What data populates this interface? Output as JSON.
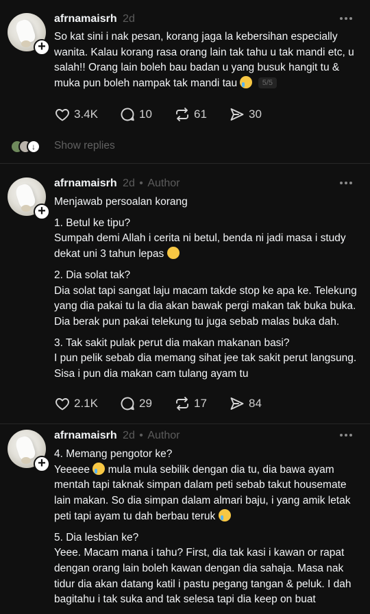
{
  "posts": [
    {
      "username": "afrnamaisrh",
      "time": "2d",
      "author_badge": "",
      "paragraphs": [
        "So kat sini i nak pesan, korang jaga la kebersihan especially\nwanita. Kalau korang rasa orang lain tak tahu u tak mandi etc, u\nsalah!! Orang lain boleh bau badan u yang busuk hangit tu &\nmuka pun boleh nampak tak mandi tau"
      ],
      "thread_counter": "5/5",
      "likes": "3.4K",
      "comments": "10",
      "reposts": "61",
      "shares": "30"
    },
    {
      "username": "afrnamaisrh",
      "time": "2d",
      "author_badge": "Author",
      "paragraphs": [
        "Menjawab persoalan korang",
        "1. Betul ke tipu?\nSumpah demi Allah i cerita ni betul, benda ni jadi masa i study\ndekat uni 3 tahun lepas",
        "2. Dia solat tak?\nDia solat tapi sangat laju macam takde stop ke apa ke. Telekung\nyang dia pakai tu la dia akan bawak pergi makan tak buka buka.\nDia berak pun pakai telekung tu juga sebab malas buka dah.",
        "3. Tak sakit pulak perut dia makan makanan basi?\nI pun pelik sebab dia memang sihat jee tak sakit perut langsung.\nSisa i pun dia makan cam tulang ayam tu"
      ],
      "likes": "2.1K",
      "comments": "29",
      "reposts": "17",
      "shares": "84"
    },
    {
      "username": "afrnamaisrh",
      "time": "2d",
      "author_badge": "Author",
      "paragraphs": [
        "4. Memang pengotor ke?\nYeeeee",
        " mula mula sebilik dengan dia tu, dia bawa ayam\nmentah tapi taknak simpan dalam peti sebab takut housemate\nlain makan. So dia simpan dalam almari baju, i yang amik letak\npeti tapi ayam tu dah berbau teruk",
        "5. Dia lesbian ke?\nYeee. Macam mana i tahu? First, dia tak kasi i kawan or rapat\ndengan orang lain boleh kawan dengan dia sahaja. Masa nak\ntidur dia akan datang katil i pastu pegang tangan & peluk. I dah\nbagitahu i tak suka and tak selesa tapi dia keep on buat"
      ]
    }
  ],
  "show_replies": "Show replies",
  "dot": "•",
  "icons": {
    "like": "heart-icon",
    "comment": "comment-bubble-icon",
    "repost": "repost-icon",
    "share": "send-icon",
    "more": "more-horizontal-icon"
  },
  "colors": {
    "background": "#101010",
    "text": "#f3f5f7",
    "muted": "#5c5c5c",
    "divider": "#272727"
  }
}
